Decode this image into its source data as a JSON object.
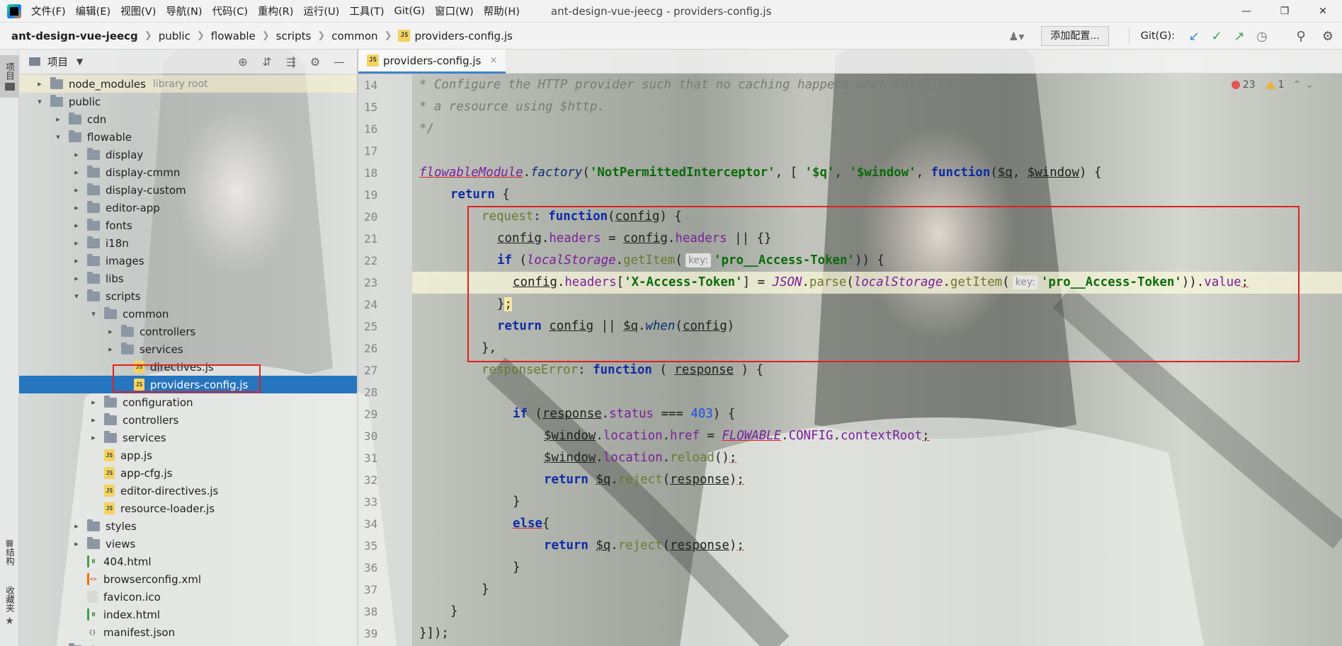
{
  "menubar": {
    "items": [
      "文件(F)",
      "编辑(E)",
      "视图(V)",
      "导航(N)",
      "代码(C)",
      "重构(R)",
      "运行(U)",
      "工具(T)",
      "Git(G)",
      "窗口(W)",
      "帮助(H)"
    ],
    "title": "ant-design-vue-jeecg - providers-config.js",
    "win_minimize": "—",
    "win_restore": "❐",
    "win_close": "✕"
  },
  "breadcrumb": [
    "ant-design-vue-jeecg",
    "public",
    "flowable",
    "scripts",
    "common",
    "providers-config.js"
  ],
  "toolbar": {
    "add_config": "添加配置...",
    "git_label": "Git(G):"
  },
  "toolstrip": {
    "project": "项目",
    "structure": "结构",
    "favorites": "收藏夹"
  },
  "project_panel": {
    "title": "项目",
    "tree": [
      {
        "label": "node_modules",
        "suffix": "library root",
        "kind": "folder",
        "expanded": false
      },
      {
        "label": "public",
        "kind": "folder",
        "expanded": true
      },
      {
        "label": "cdn",
        "kind": "folder",
        "expanded": false
      },
      {
        "label": "flowable",
        "kind": "folder",
        "expanded": true
      },
      {
        "label": "display",
        "kind": "folder",
        "expanded": false
      },
      {
        "label": "display-cmmn",
        "kind": "folder",
        "expanded": false
      },
      {
        "label": "display-custom",
        "kind": "folder",
        "expanded": false
      },
      {
        "label": "editor-app",
        "kind": "folder",
        "expanded": false
      },
      {
        "label": "fonts",
        "kind": "folder",
        "expanded": false
      },
      {
        "label": "i18n",
        "kind": "folder",
        "expanded": false
      },
      {
        "label": "images",
        "kind": "folder",
        "expanded": false
      },
      {
        "label": "libs",
        "kind": "folder",
        "expanded": false
      },
      {
        "label": "scripts",
        "kind": "folder",
        "expanded": true
      },
      {
        "label": "common",
        "kind": "folder",
        "expanded": true
      },
      {
        "label": "controllers",
        "kind": "folder",
        "expanded": false
      },
      {
        "label": "services",
        "kind": "folder",
        "expanded": false
      },
      {
        "label": "directives.js",
        "kind": "js"
      },
      {
        "label": "providers-config.js",
        "kind": "js",
        "selected": true
      },
      {
        "label": "configuration",
        "kind": "folder",
        "expanded": false
      },
      {
        "label": "controllers",
        "kind": "folder",
        "expanded": false
      },
      {
        "label": "services",
        "kind": "folder",
        "expanded": false
      },
      {
        "label": "app.js",
        "kind": "js"
      },
      {
        "label": "app-cfg.js",
        "kind": "js"
      },
      {
        "label": "editor-directives.js",
        "kind": "js"
      },
      {
        "label": "resource-loader.js",
        "kind": "js"
      },
      {
        "label": "styles",
        "kind": "folder",
        "expanded": false
      },
      {
        "label": "views",
        "kind": "folder",
        "expanded": false
      },
      {
        "label": "404.html",
        "kind": "html"
      },
      {
        "label": "browserconfig.xml",
        "kind": "xml"
      },
      {
        "label": "favicon.ico",
        "kind": "ico"
      },
      {
        "label": "index.html",
        "kind": "html"
      },
      {
        "label": "manifest.json",
        "kind": "json"
      },
      {
        "label": "ti...",
        "kind": "folder",
        "expanded": false
      }
    ]
  },
  "editor": {
    "tab_label": "providers-config.js",
    "tab_close": "×",
    "errors": "23",
    "warnings": "1",
    "line_numbers": [
      "14",
      "15",
      "16",
      "17",
      "18",
      "19",
      "20",
      "21",
      "22",
      "23",
      "24",
      "25",
      "26",
      "27",
      "28",
      "29",
      "30",
      "31",
      "32",
      "33",
      "34",
      "35",
      "36",
      "37",
      "38",
      "39"
    ]
  },
  "code": {
    "l14": "* Configure the HTTP provider such that no caching happens when fetching",
    "l15": "* a resource using $http.",
    "l16": "*/",
    "l18_module": "flowableModule",
    "l18_factory": "factory",
    "l18_interceptor": "'NotPermittedInterceptor'",
    "l18_q": "'$q'",
    "l18_window": "'$window'",
    "l18_function": "function",
    "l18_pq": "$q",
    "l18_pwindow": "$window",
    "return": "return",
    "request": "request",
    "function": "function",
    "config": "config",
    "headers": "headers",
    "if": "if",
    "localStorage": "localStorage",
    "getItem": "getItem",
    "key_hint": "key:",
    "access_token_key": "'pro__Access-Token'",
    "x_access_token": "'X-Access-Token'",
    "JSON": "JSON",
    "parse": "parse",
    "value": "value",
    "when": "when",
    "responseError": "responseError",
    "response": "response",
    "status": "status",
    "status_code": "403",
    "window_var": "$window",
    "location": "location",
    "href": "href",
    "FLOWABLE": "FLOWABLE",
    "CONFIG": "CONFIG",
    "contextRoot": "contextRoot",
    "reload": "reload",
    "q_var": "$q",
    "reject": "reject",
    "else": "else"
  }
}
